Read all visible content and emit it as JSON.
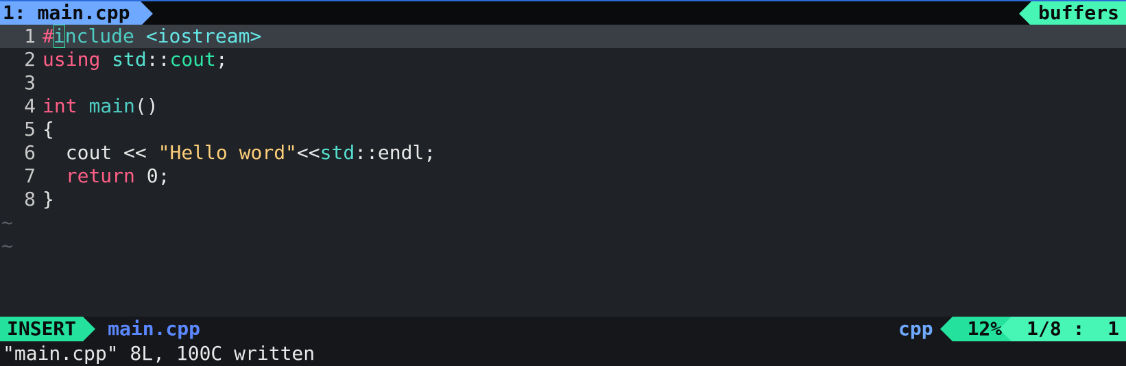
{
  "tabline": {
    "tab_index": "1: ",
    "tab_file": "main.cpp",
    "buffers_label": " buffers "
  },
  "editor": {
    "lines": [
      {
        "num": "1",
        "current": true,
        "cursor_at": 1,
        "tokens": [
          {
            "cls": "tok-preproc-hash",
            "text": "#"
          },
          {
            "cls": "tok-preproc-word",
            "text": "include "
          },
          {
            "cls": "tok-angle-inc",
            "text": "<iostream>"
          }
        ]
      },
      {
        "num": "2",
        "tokens": [
          {
            "cls": "tok-kw-using",
            "text": "using "
          },
          {
            "cls": "tok-ns",
            "text": "std"
          },
          {
            "cls": "tok-scope",
            "text": "::"
          },
          {
            "cls": "tok-ident",
            "text": "cout"
          },
          {
            "cls": "tok-semi",
            "text": ";"
          }
        ]
      },
      {
        "num": "3",
        "tokens": []
      },
      {
        "num": "4",
        "tokens": [
          {
            "cls": "tok-kw-type",
            "text": "int "
          },
          {
            "cls": "tok-func",
            "text": "main"
          },
          {
            "cls": "tok-paren",
            "text": "()"
          }
        ]
      },
      {
        "num": "5",
        "tokens": [
          {
            "cls": "tok-brace",
            "text": "{"
          }
        ]
      },
      {
        "num": "6",
        "tokens": [
          {
            "cls": "",
            "text": "  "
          },
          {
            "cls": "tok-ident2",
            "text": "cout "
          },
          {
            "cls": "tok-op",
            "text": "<< "
          },
          {
            "cls": "tok-string",
            "text": "\"Hello word\""
          },
          {
            "cls": "tok-op",
            "text": "<<"
          },
          {
            "cls": "tok-ns",
            "text": "std"
          },
          {
            "cls": "tok-scope",
            "text": "::"
          },
          {
            "cls": "tok-ident2",
            "text": "endl"
          },
          {
            "cls": "tok-semi",
            "text": ";"
          }
        ]
      },
      {
        "num": "7",
        "tokens": [
          {
            "cls": "",
            "text": "  "
          },
          {
            "cls": "tok-kw-ret",
            "text": "return "
          },
          {
            "cls": "tok-num",
            "text": "0"
          },
          {
            "cls": "tok-semi",
            "text": ";"
          }
        ]
      },
      {
        "num": "8",
        "tokens": [
          {
            "cls": "tok-brace",
            "text": "}"
          }
        ]
      }
    ],
    "tilde_rows": 2,
    "tilde_char": "~"
  },
  "status": {
    "mode": " INSERT ",
    "file": "main.cpp",
    "filetype": "cpp",
    "percent": "12%",
    "position": "1/8 :  1"
  },
  "cmdline": {
    "message": "\"main.cpp\" 8L, 100C written"
  }
}
